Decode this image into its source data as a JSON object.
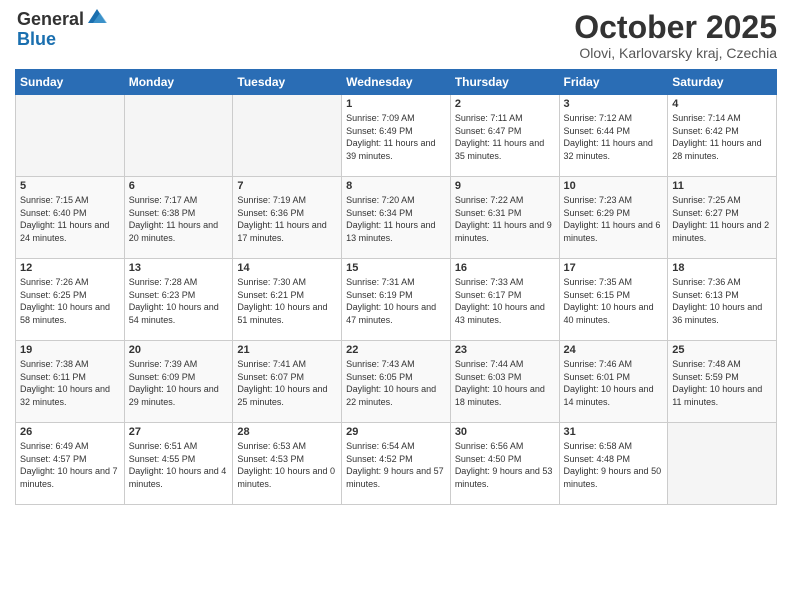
{
  "header": {
    "logo_general": "General",
    "logo_blue": "Blue",
    "month": "October 2025",
    "location": "Olovi, Karlovarsky kraj, Czechia"
  },
  "days_of_week": [
    "Sunday",
    "Monday",
    "Tuesday",
    "Wednesday",
    "Thursday",
    "Friday",
    "Saturday"
  ],
  "weeks": [
    [
      {
        "day": "",
        "info": ""
      },
      {
        "day": "",
        "info": ""
      },
      {
        "day": "",
        "info": ""
      },
      {
        "day": "1",
        "info": "Sunrise: 7:09 AM\nSunset: 6:49 PM\nDaylight: 11 hours and 39 minutes."
      },
      {
        "day": "2",
        "info": "Sunrise: 7:11 AM\nSunset: 6:47 PM\nDaylight: 11 hours and 35 minutes."
      },
      {
        "day": "3",
        "info": "Sunrise: 7:12 AM\nSunset: 6:44 PM\nDaylight: 11 hours and 32 minutes."
      },
      {
        "day": "4",
        "info": "Sunrise: 7:14 AM\nSunset: 6:42 PM\nDaylight: 11 hours and 28 minutes."
      }
    ],
    [
      {
        "day": "5",
        "info": "Sunrise: 7:15 AM\nSunset: 6:40 PM\nDaylight: 11 hours and 24 minutes."
      },
      {
        "day": "6",
        "info": "Sunrise: 7:17 AM\nSunset: 6:38 PM\nDaylight: 11 hours and 20 minutes."
      },
      {
        "day": "7",
        "info": "Sunrise: 7:19 AM\nSunset: 6:36 PM\nDaylight: 11 hours and 17 minutes."
      },
      {
        "day": "8",
        "info": "Sunrise: 7:20 AM\nSunset: 6:34 PM\nDaylight: 11 hours and 13 minutes."
      },
      {
        "day": "9",
        "info": "Sunrise: 7:22 AM\nSunset: 6:31 PM\nDaylight: 11 hours and 9 minutes."
      },
      {
        "day": "10",
        "info": "Sunrise: 7:23 AM\nSunset: 6:29 PM\nDaylight: 11 hours and 6 minutes."
      },
      {
        "day": "11",
        "info": "Sunrise: 7:25 AM\nSunset: 6:27 PM\nDaylight: 11 hours and 2 minutes."
      }
    ],
    [
      {
        "day": "12",
        "info": "Sunrise: 7:26 AM\nSunset: 6:25 PM\nDaylight: 10 hours and 58 minutes."
      },
      {
        "day": "13",
        "info": "Sunrise: 7:28 AM\nSunset: 6:23 PM\nDaylight: 10 hours and 54 minutes."
      },
      {
        "day": "14",
        "info": "Sunrise: 7:30 AM\nSunset: 6:21 PM\nDaylight: 10 hours and 51 minutes."
      },
      {
        "day": "15",
        "info": "Sunrise: 7:31 AM\nSunset: 6:19 PM\nDaylight: 10 hours and 47 minutes."
      },
      {
        "day": "16",
        "info": "Sunrise: 7:33 AM\nSunset: 6:17 PM\nDaylight: 10 hours and 43 minutes."
      },
      {
        "day": "17",
        "info": "Sunrise: 7:35 AM\nSunset: 6:15 PM\nDaylight: 10 hours and 40 minutes."
      },
      {
        "day": "18",
        "info": "Sunrise: 7:36 AM\nSunset: 6:13 PM\nDaylight: 10 hours and 36 minutes."
      }
    ],
    [
      {
        "day": "19",
        "info": "Sunrise: 7:38 AM\nSunset: 6:11 PM\nDaylight: 10 hours and 32 minutes."
      },
      {
        "day": "20",
        "info": "Sunrise: 7:39 AM\nSunset: 6:09 PM\nDaylight: 10 hours and 29 minutes."
      },
      {
        "day": "21",
        "info": "Sunrise: 7:41 AM\nSunset: 6:07 PM\nDaylight: 10 hours and 25 minutes."
      },
      {
        "day": "22",
        "info": "Sunrise: 7:43 AM\nSunset: 6:05 PM\nDaylight: 10 hours and 22 minutes."
      },
      {
        "day": "23",
        "info": "Sunrise: 7:44 AM\nSunset: 6:03 PM\nDaylight: 10 hours and 18 minutes."
      },
      {
        "day": "24",
        "info": "Sunrise: 7:46 AM\nSunset: 6:01 PM\nDaylight: 10 hours and 14 minutes."
      },
      {
        "day": "25",
        "info": "Sunrise: 7:48 AM\nSunset: 5:59 PM\nDaylight: 10 hours and 11 minutes."
      }
    ],
    [
      {
        "day": "26",
        "info": "Sunrise: 6:49 AM\nSunset: 4:57 PM\nDaylight: 10 hours and 7 minutes."
      },
      {
        "day": "27",
        "info": "Sunrise: 6:51 AM\nSunset: 4:55 PM\nDaylight: 10 hours and 4 minutes."
      },
      {
        "day": "28",
        "info": "Sunrise: 6:53 AM\nSunset: 4:53 PM\nDaylight: 10 hours and 0 minutes."
      },
      {
        "day": "29",
        "info": "Sunrise: 6:54 AM\nSunset: 4:52 PM\nDaylight: 9 hours and 57 minutes."
      },
      {
        "day": "30",
        "info": "Sunrise: 6:56 AM\nSunset: 4:50 PM\nDaylight: 9 hours and 53 minutes."
      },
      {
        "day": "31",
        "info": "Sunrise: 6:58 AM\nSunset: 4:48 PM\nDaylight: 9 hours and 50 minutes."
      },
      {
        "day": "",
        "info": ""
      }
    ]
  ]
}
